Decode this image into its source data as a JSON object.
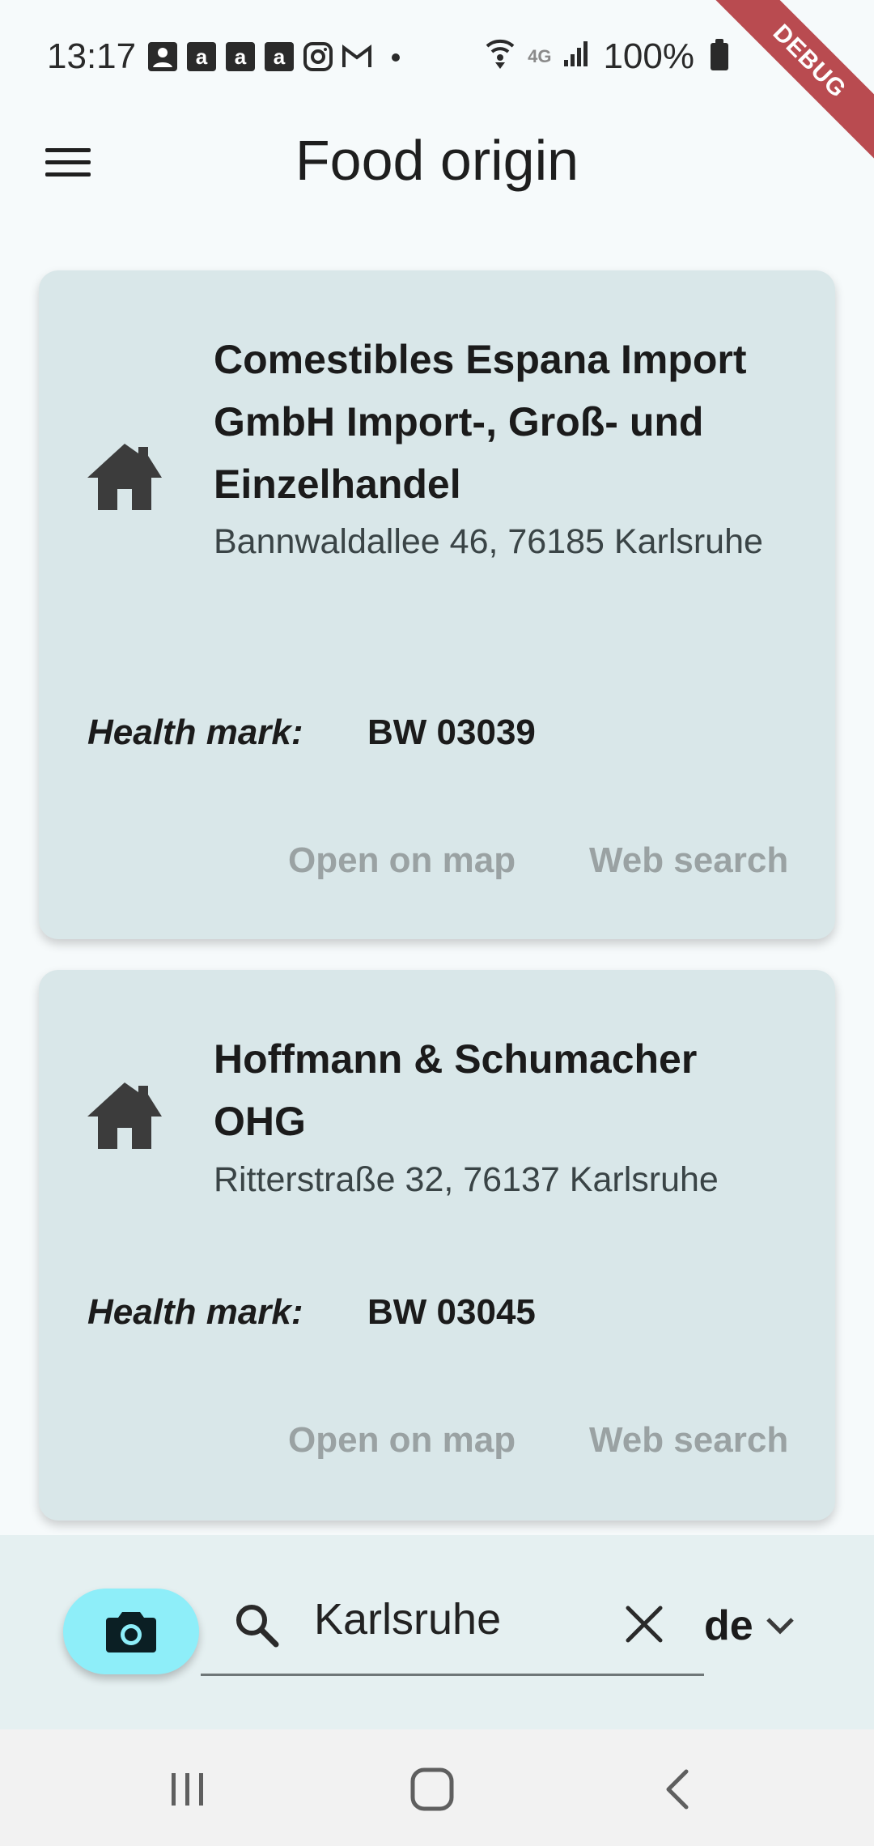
{
  "status_bar": {
    "time": "13:17",
    "battery": "100%",
    "network": "4G",
    "left_icons": [
      "contact-icon",
      "amazon-icon",
      "amazon-icon",
      "amazon-icon",
      "instagram-icon",
      "gmail-icon",
      "dot-icon"
    ],
    "right_icons": [
      "wifi-icon",
      "4g-icon",
      "signal-icon",
      "battery-icon"
    ]
  },
  "debug_banner": "DEBUG",
  "app_bar": {
    "title": "Food origin",
    "menu_icon": "hamburger-menu-icon"
  },
  "results": [
    {
      "name": "Comestibles Espana Import GmbH Import-, Groß- und Einzelhandel",
      "address": "Bannwaldallee 46, 76185 Karlsruhe",
      "health_mark_label": "Health mark:",
      "health_mark": "BW 03039",
      "open_map_label": "Open on map",
      "web_search_label": "Web search",
      "icon": "home-icon"
    },
    {
      "name": "Hoffmann & Schumacher OHG",
      "address": "Ritterstraße 32, 76137 Karlsruhe",
      "health_mark_label": "Health mark:",
      "health_mark": "BW 03045",
      "open_map_label": "Open on map",
      "web_search_label": "Web search",
      "icon": "home-icon"
    }
  ],
  "search": {
    "value": "Karlsruhe",
    "language": "de"
  },
  "colors": {
    "background": "#f6fafb",
    "card": "#d9e7e9",
    "fab": "#8eeef9",
    "debug": "#b3393e",
    "action_text": "#9aa2a3"
  }
}
